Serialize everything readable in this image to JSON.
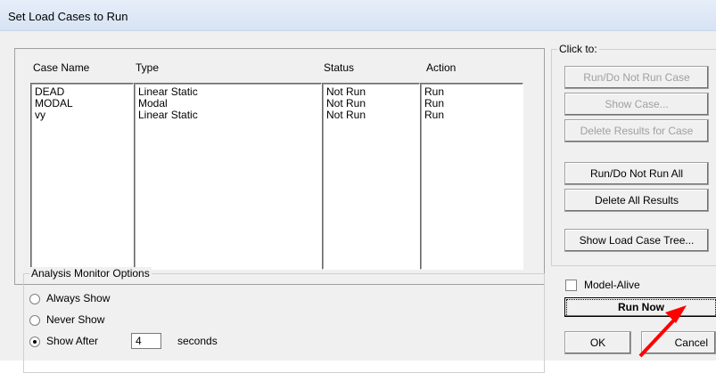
{
  "window": {
    "title": "Set Load Cases to Run"
  },
  "cases_table": {
    "headers": {
      "case_name": "Case Name",
      "type": "Type",
      "status": "Status",
      "action": "Action"
    },
    "rows": [
      {
        "case_name": "DEAD",
        "type": "Linear Static",
        "status": "Not Run",
        "action": "Run"
      },
      {
        "case_name": "MODAL",
        "type": "Modal",
        "status": "Not Run",
        "action": "Run"
      },
      {
        "case_name": "vy",
        "type": "Linear Static",
        "status": "Not Run",
        "action": "Run"
      }
    ]
  },
  "click_to": {
    "legend": "Click to:",
    "run_do_not_run_case": "Run/Do Not Run Case",
    "show_case": "Show Case...",
    "delete_results_for_case": "Delete Results for Case",
    "run_do_not_run_all": "Run/Do Not Run All",
    "delete_all_results": "Delete All Results",
    "show_load_case_tree": "Show Load Case Tree..."
  },
  "monitor": {
    "legend": "Analysis Monitor Options",
    "always_show": "Always Show",
    "never_show": "Never Show",
    "show_after": "Show After",
    "seconds_value": "4",
    "seconds_label": "seconds",
    "selected": "show_after"
  },
  "model_alive": {
    "label": "Model-Alive",
    "checked": false
  },
  "buttons": {
    "run_now": "Run Now",
    "ok": "OK",
    "cancel": "Cancel"
  },
  "colors": {
    "annotation_arrow": "#ff0000",
    "title_bar": "#dbe6f4"
  }
}
